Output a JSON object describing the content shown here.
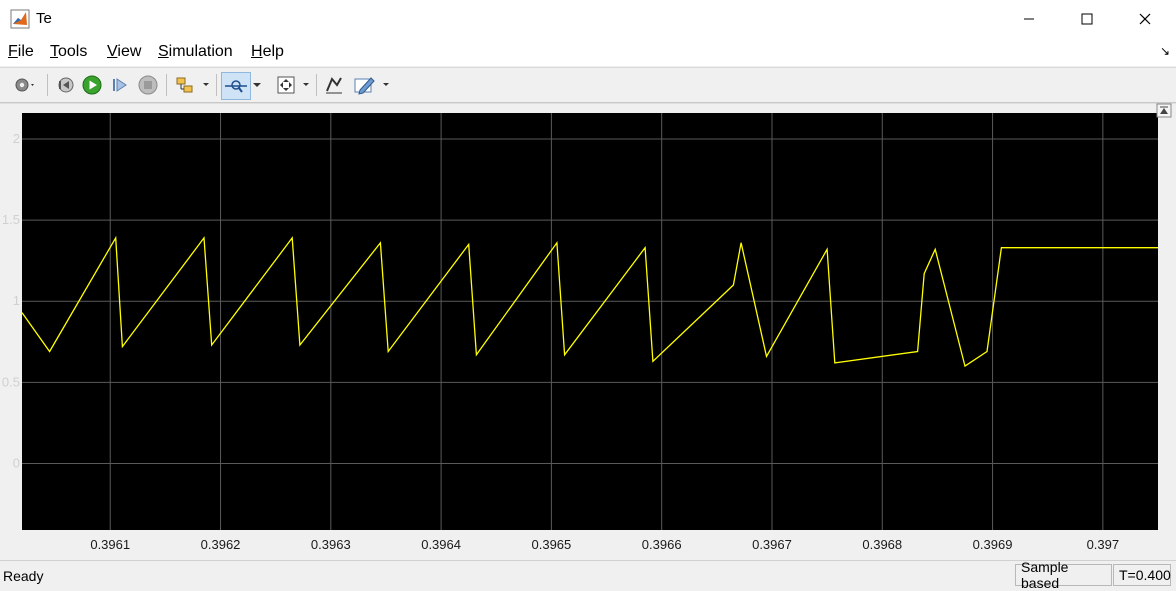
{
  "window": {
    "title": "Te"
  },
  "menu": [
    {
      "label": "File",
      "key": "F",
      "rest": "ile"
    },
    {
      "label": "Tools",
      "key": "T",
      "rest": "ools"
    },
    {
      "label": "View",
      "key": "V",
      "rest": "iew"
    },
    {
      "label": "Simulation",
      "key": "S",
      "rest": "imulation"
    },
    {
      "label": "Help",
      "key": "H",
      "rest": "elp"
    }
  ],
  "status": {
    "state": "Ready",
    "mode": "Sample based",
    "time": "T=0.400"
  },
  "colors": {
    "plot_bg": "#000000",
    "grid": "#5a5a5a",
    "trace": "#ffff00",
    "tick_text": "#d0d0d0"
  },
  "chart_data": {
    "type": "line",
    "title": "",
    "xlabel": "",
    "ylabel": "",
    "xlim": [
      0.39602,
      0.39705
    ],
    "ylim": [
      -0.41,
      2.16
    ],
    "grid": true,
    "x_ticks": [
      0.3961,
      0.3962,
      0.3963,
      0.3964,
      0.3965,
      0.3966,
      0.3967,
      0.3968,
      0.3969,
      0.397
    ],
    "x_tick_labels": [
      "0.3961",
      "0.3962",
      "0.3963",
      "0.3964",
      "0.3965",
      "0.3966",
      "0.3967",
      "0.3968",
      "0.3969",
      "0.397"
    ],
    "y_ticks": [
      0,
      0.5,
      1,
      1.5,
      2
    ],
    "y_tick_labels": [
      "0",
      "0.5",
      "1",
      "1.5",
      "2"
    ],
    "series": [
      {
        "color": "#ffff00",
        "x": [
          0.39602,
          0.396045,
          0.396105,
          0.396111,
          0.396185,
          0.396192,
          0.396265,
          0.396272,
          0.396345,
          0.396352,
          0.396425,
          0.396432,
          0.396505,
          0.396512,
          0.396585,
          0.396592,
          0.396665,
          0.396672,
          0.396695,
          0.39675,
          0.396757,
          0.396832,
          0.396838,
          0.396848,
          0.396875,
          0.396895,
          0.396908,
          0.39705
        ],
        "y": [
          0.93,
          0.69,
          1.39,
          0.72,
          1.39,
          0.73,
          1.39,
          0.73,
          1.36,
          0.69,
          1.35,
          0.67,
          1.36,
          0.67,
          1.33,
          0.63,
          1.1,
          1.36,
          0.66,
          1.32,
          0.62,
          0.69,
          1.17,
          1.32,
          0.6,
          0.69,
          1.33,
          1.33
        ]
      }
    ]
  }
}
